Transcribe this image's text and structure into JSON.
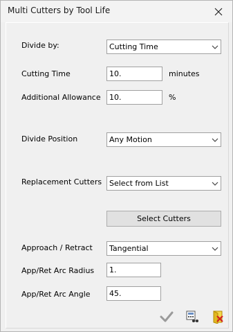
{
  "window": {
    "title": "Multi Cutters by Tool Life"
  },
  "form": {
    "divide_by_label": "Divide by:",
    "divide_by_value": "Cutting Time",
    "cutting_time_label": "Cutting Time",
    "cutting_time_value": "10.",
    "cutting_time_unit": "minutes",
    "allowance_label": "Additional Allowance",
    "allowance_value": "10.",
    "allowance_unit": "%",
    "divide_position_label": "Divide Position",
    "divide_position_value": "Any Motion",
    "replacement_label": "Replacement Cutters",
    "replacement_value": "Select from List",
    "select_cutters_label": "Select Cutters",
    "approach_label": "Approach / Retract",
    "approach_value": "Tangential",
    "arc_radius_label": "App/Ret Arc Radius",
    "arc_radius_value": "1.",
    "arc_angle_label": "App/Ret Arc Angle",
    "arc_angle_value": "45."
  },
  "icons": [
    "close-icon",
    "chevron-down-icon",
    "checkmark-icon",
    "calculator-icon",
    "exit-icon"
  ]
}
